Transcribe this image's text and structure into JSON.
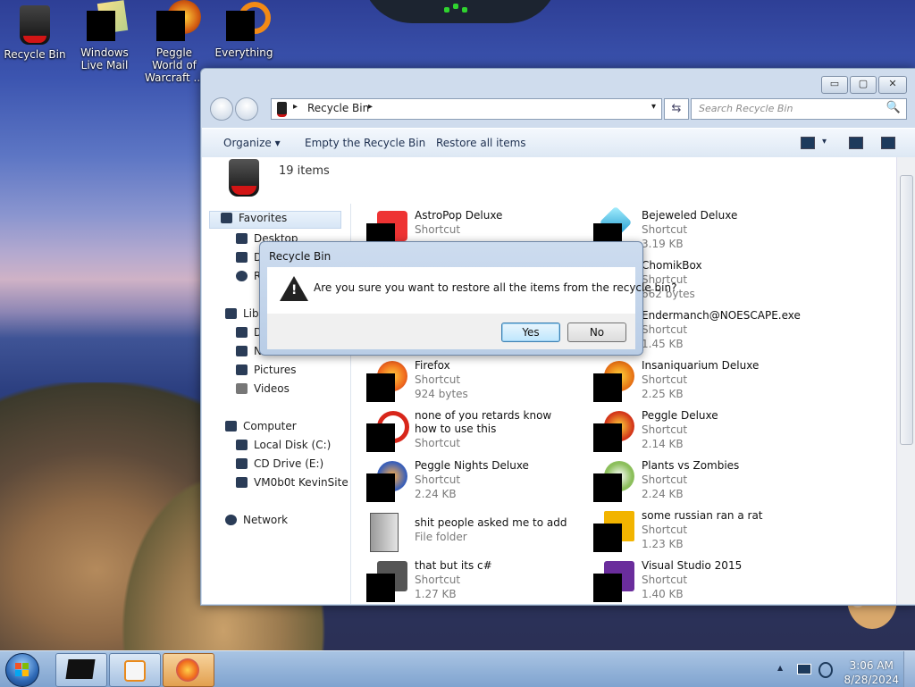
{
  "desktop": {
    "icons": [
      {
        "label": "Recycle Bin",
        "icon": "recycle-bin-icon"
      },
      {
        "label": "Windows Live Mail",
        "icon": "windows-live-mail-icon"
      },
      {
        "label": "Peggle World of Warcraft ...",
        "icon": "peggle-wow-icon"
      },
      {
        "label": "Everything",
        "icon": "everything-icon"
      }
    ]
  },
  "window": {
    "title": "Recycle Bin",
    "controls": {
      "minimize": "▭",
      "maximize": "▢",
      "close": "✕"
    },
    "address": {
      "location": "Recycle Bin",
      "sep1": "▸",
      "sep2": "▸",
      "dropdown": "▾",
      "refresh": "⇆"
    },
    "search": {
      "placeholder": "Search Recycle Bin",
      "icon": "🔍"
    },
    "toolbar": {
      "organize": "Organize ▾",
      "empty": "Empty the Recycle Bin",
      "restore": "Restore all items",
      "view_arrow": "▾"
    },
    "item_count": "19 items",
    "nav": {
      "favorites": "Favorites",
      "desktop": "Desktop",
      "downloads": "D",
      "recent": "R",
      "libraries": "Lib",
      "lib_docs": "D",
      "lib_music": "N",
      "pictures": "Pictures",
      "videos": "Videos",
      "computer": "Computer",
      "local_disk": "Local Disk (C:)",
      "cd_drive": "CD Drive (E:)",
      "vm": "VM0b0t KevinSite",
      "network": "Network"
    },
    "files_left": [
      {
        "name": "AstroPop Deluxe",
        "line2": "Shortcut",
        "line3": ""
      },
      {
        "name": "",
        "line2": "",
        "line3": ""
      },
      {
        "name": "",
        "line2": "",
        "line3": ""
      },
      {
        "name": "Firefox",
        "line2": "Shortcut",
        "line3": "924 bytes"
      },
      {
        "name": "none of you retards know how to use this",
        "line2": "Shortcut",
        "line3": ""
      },
      {
        "name": "Peggle Nights Deluxe",
        "line2": "Shortcut",
        "line3": "2.24 KB"
      },
      {
        "name": "shit people asked me to add",
        "line2": "File folder",
        "line3": ""
      },
      {
        "name": "that but its c#",
        "line2": "Shortcut",
        "line3": "1.27 KB"
      }
    ],
    "files_right": [
      {
        "name": "Bejeweled Deluxe",
        "line2": "Shortcut",
        "line3": "3.19 KB"
      },
      {
        "name": "ChomikBox",
        "line2": "Shortcut",
        "line3": "662 bytes"
      },
      {
        "name": "Endermanch@NOESCAPE.exe",
        "line2": "Shortcut",
        "line3": "1.45 KB"
      },
      {
        "name": "Insaniquarium Deluxe",
        "line2": "Shortcut",
        "line3": "2.25 KB"
      },
      {
        "name": "Peggle Deluxe",
        "line2": "Shortcut",
        "line3": "2.14 KB"
      },
      {
        "name": "Plants vs Zombies",
        "line2": "Shortcut",
        "line3": "2.24 KB"
      },
      {
        "name": "some russian ran a rat",
        "line2": "Shortcut",
        "line3": "1.23 KB"
      },
      {
        "name": "Visual Studio 2015",
        "line2": "Shortcut",
        "line3": "1.40 KB"
      }
    ]
  },
  "dialog": {
    "title": "Recycle Bin",
    "message": "Are you sure you want to restore all the items from the recycle bin?",
    "yes": "Yes",
    "no": "No"
  },
  "taskbar": {
    "time": "3:06 AM",
    "date": "8/28/2024",
    "tray_arrow": "▲"
  }
}
